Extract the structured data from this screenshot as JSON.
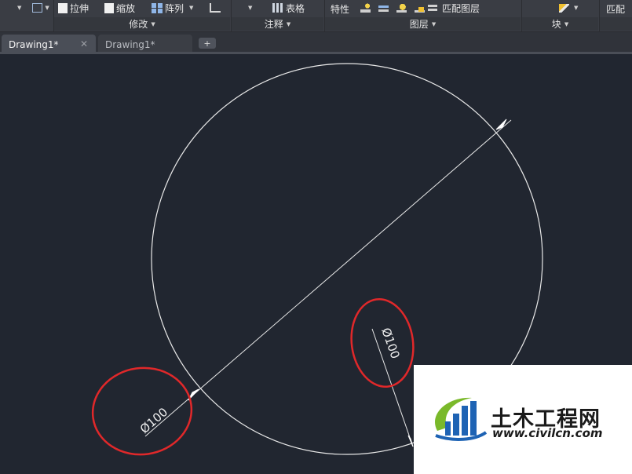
{
  "ribbon": {
    "tools": {
      "stretch": "拉伸",
      "scale": "缩放",
      "array": "阵列",
      "table": "表格",
      "properties": "特性",
      "match_layer": "匹配图层",
      "match": "匹配"
    },
    "panels": {
      "modify": "修改",
      "annotate": "注释",
      "layers": "图层",
      "block": "块"
    }
  },
  "tabs": [
    {
      "label": "Drawing1*",
      "active": true
    },
    {
      "label": "Drawing1*",
      "active": false
    }
  ],
  "tab_add": "+",
  "drawing": {
    "dim_text_1": "Ø100",
    "dim_text_2": "Ø100",
    "circle_color": "#e8e8e8",
    "highlight_color": "#e0282a"
  },
  "logo": {
    "name": "土木工程网",
    "url": "www.civilcn.com",
    "blue": "#1e63b4",
    "green": "#7ab92a"
  }
}
